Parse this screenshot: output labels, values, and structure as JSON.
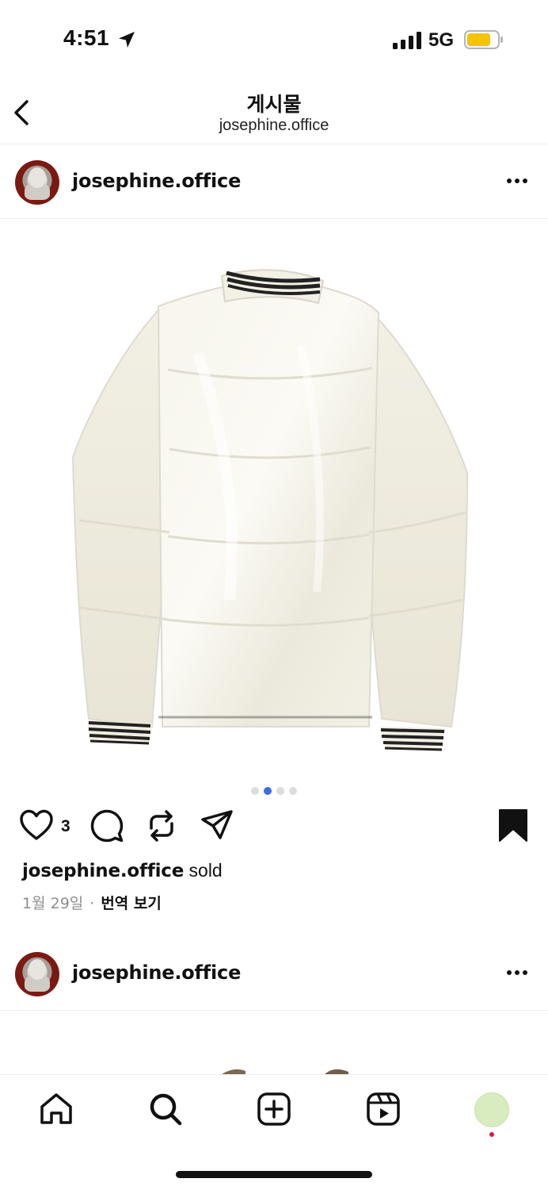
{
  "status_bar": {
    "time": "4:51",
    "network": "5G",
    "battery_color": "#f5c400"
  },
  "header": {
    "title": "게시물",
    "subtitle": "josephine.office",
    "back_icon": "chevron-left-icon"
  },
  "post": {
    "username": "josephine.office",
    "more_icon": "ellipsis-icon",
    "image_subject": "jacket",
    "carousel": {
      "count": 4,
      "active_index": 1,
      "active_color": "#3a6fe0"
    },
    "likes": "3",
    "caption_user": "josephine.office",
    "caption_text": " sold",
    "date": "1월 29일",
    "separator": "·",
    "translate_label": "번역 보기"
  },
  "next_post": {
    "username": "josephine.office"
  },
  "bottom_nav": {
    "items": [
      "home-icon",
      "search-icon",
      "create-icon",
      "reels-icon",
      "profile-icon"
    ],
    "notification_color": "#e0143c"
  }
}
